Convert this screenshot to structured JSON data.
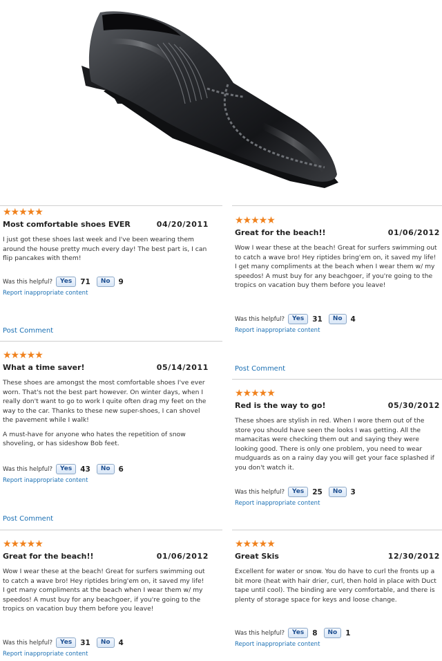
{
  "product_image": {
    "alt": "black leather square-toe slip-on shoe"
  },
  "ui": {
    "helpful_label": "Was this helpful?",
    "yes_label": "Yes",
    "no_label": "No",
    "report_label": "Report inappropriate content",
    "post_comment_label": "Post Comment",
    "stars": "★★★★★"
  },
  "colors": {
    "stars": "#f0821e",
    "link": "#1a6fb3"
  },
  "left_reviews": [
    {
      "title": "Most comfortable shoes EVER",
      "date": "04/20/2011",
      "paragraphs": [
        "I just got these shoes last week and I've been wearing them around the house pretty much every day! The best part is, I can flip pancakes with them!"
      ],
      "yes": "71",
      "no": "9",
      "rating": 5
    },
    {
      "title": "What a time saver!",
      "date": "05/14/2011",
      "paragraphs": [
        "These shoes are amongst the most comfortable shoes I've ever worn. That's not the best part however. On winter days, when I really don't want to go to work I quite often drag my feet on the way to the car. Thanks to these new super-shoes, I can shovel the pavement while I walk!",
        "A must-have for anyone who hates the repetition of snow shoveling, or has sideshow Bob feet."
      ],
      "yes": "43",
      "no": "6",
      "rating": 5
    },
    {
      "title": "Great for the beach!!",
      "date": "01/06/2012",
      "paragraphs": [
        "Wow I wear these at the beach! Great for surfers swimming out to catch a wave bro! Hey riptides bring'em on, it saved my life! I get many compliments at the beach when I wear them w/ my speedos! A must buy for any beachgoer, if you're going to the tropics on vacation buy them before you leave!"
      ],
      "yes": "31",
      "no": "4",
      "rating": 5
    }
  ],
  "right_reviews": [
    {
      "title": "Great for the beach!!",
      "date": "01/06/2012",
      "paragraphs": [
        "Wow I wear these at the beach! Great for surfers swimming out to catch a wave bro! Hey riptides bring'em on, it saved my life! I get many compliments at the beach when I wear them w/ my speedos! A must buy for any beachgoer, if you're going to the tropics on vacation buy them before you leave!"
      ],
      "yes": "31",
      "no": "4",
      "rating": 5
    },
    {
      "title": "Red is the way to go!",
      "date": "05/30/2012",
      "paragraphs": [
        "These shoes are stylish in red. When I wore them out of the store you should have seen the looks I was getting. All the mamacitas were checking them out and saying they were looking good. There is only one problem, you need to wear mudguards as on a rainy day you will get your face splashed if you don't watch it."
      ],
      "yes": "25",
      "no": "3",
      "rating": 5
    },
    {
      "title": "Great Skis",
      "date": "12/30/2012",
      "paragraphs": [
        "Excellent for water or snow. You do have to curl the fronts up a bit more (heat with hair drier, curl, then hold in place with Duct tape until cool). The binding are very comfortable, and there is plenty of storage space for keys and loose change."
      ],
      "yes": "8",
      "no": "1",
      "rating": 5
    }
  ]
}
